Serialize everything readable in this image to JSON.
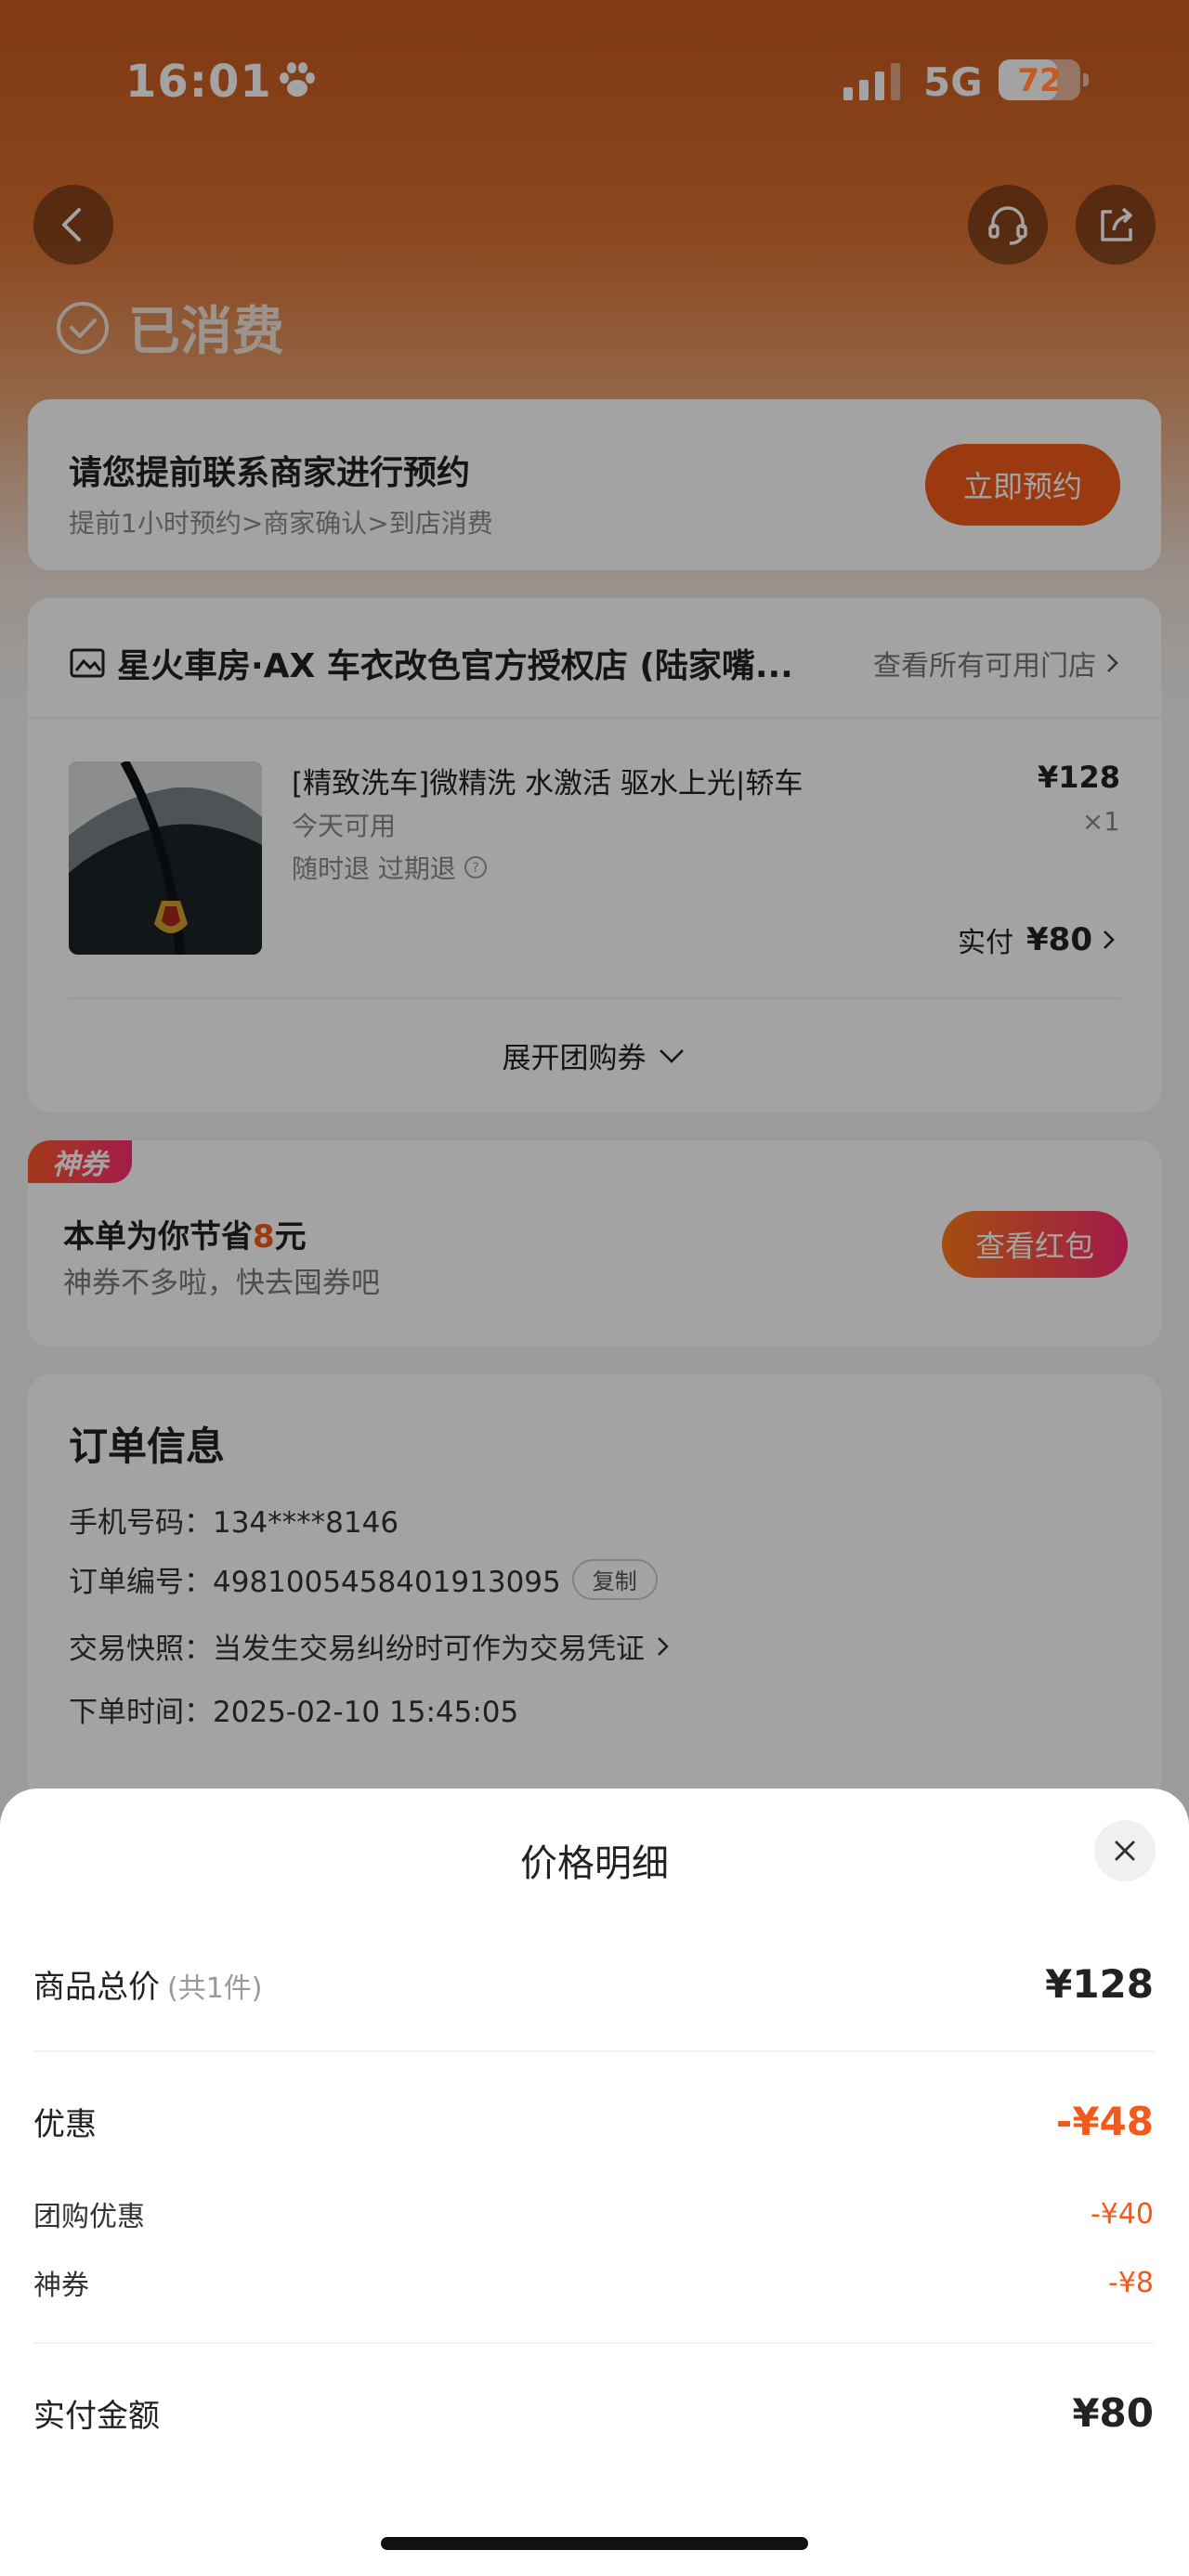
{
  "status_bar": {
    "time": "16:01",
    "network": "5G",
    "battery": "72",
    "battery_level": 0.72
  },
  "header": {
    "status": "已消费"
  },
  "booking": {
    "title": "请您提前联系商家进行预约",
    "subtitle": "提前1小时预约>商家确认>到店消费",
    "button": "立即预约"
  },
  "store": {
    "name": "星火車房·AX 车衣改色官方授权店 (陆家嘴...",
    "all_stores": "查看所有可用门店",
    "product": {
      "title": "[精致洗车]微精洗 水激活 驱水上光|轿车",
      "availability": "今天可用",
      "refund": "随时退 过期退",
      "price": "¥128",
      "quantity": "×1",
      "paid_label": "实付",
      "paid_amount": "¥80"
    },
    "expand_label": "展开团购券"
  },
  "coupon": {
    "badge": "神券",
    "title_prefix": "本单为你节省",
    "saved": "8",
    "title_suffix": "元",
    "subtitle": "神券不多啦，快去囤券吧",
    "button": "查看红包"
  },
  "order_info": {
    "title": "订单信息",
    "phone": "手机号码：134****8146",
    "order_no": "订单编号：4981005458401913095",
    "copy": "复制",
    "snapshot": "交易快照：当发生交易纠纷时可作为交易凭证",
    "order_time": "下单时间：2025-02-10 15:45:05"
  },
  "price_sheet": {
    "title": "价格明细",
    "total_label": "商品总价",
    "total_count": "(共1件)",
    "total_value": "¥128",
    "discount_label": "优惠",
    "discount_value": "-¥48",
    "groupbuy_label": "团购优惠",
    "groupbuy_value": "-¥40",
    "coupon_label": "神券",
    "coupon_value": "-¥8",
    "paid_label": "实付金额",
    "paid_value": "¥80"
  },
  "colors": {
    "accent": "#f25a1c",
    "header_gradient_top": "#c95a1f",
    "coupon_gradient_end": "#ff2a72"
  }
}
